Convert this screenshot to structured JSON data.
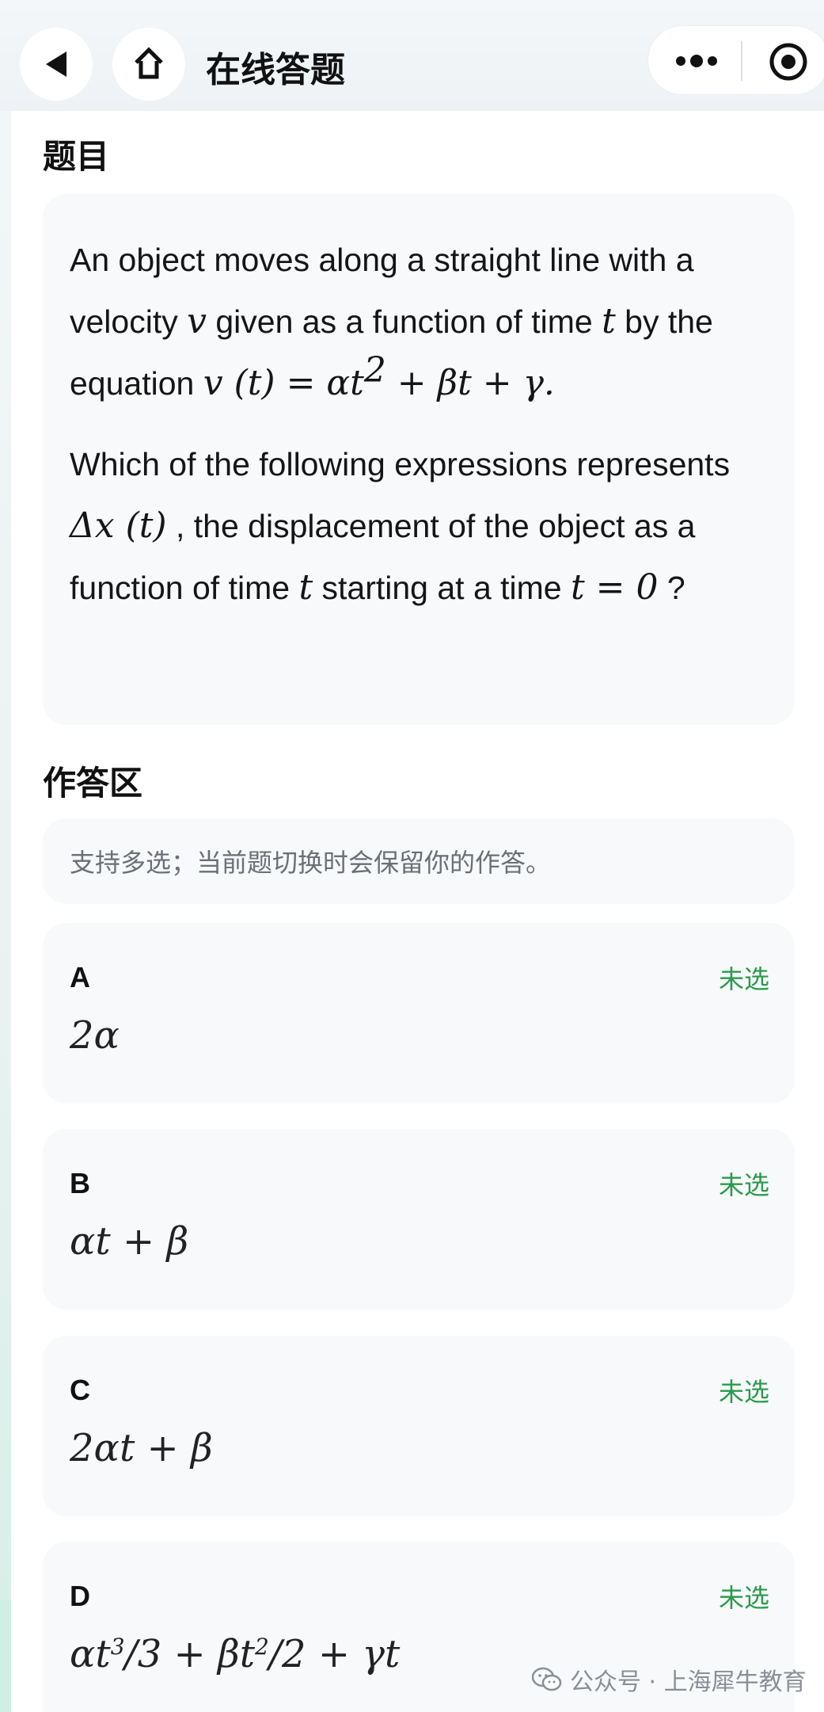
{
  "header": {
    "title": "在线答题"
  },
  "question": {
    "section_title": "题目",
    "p1": {
      "a": "An object moves along a straight line with a velocity ",
      "v": "v",
      "b": " given as a function of time ",
      "t": "t",
      "c": " by the equation ",
      "eq_lhs": "v (t) = αt",
      "eq_exp": "2",
      "eq_rhs": " + βt + γ."
    },
    "p2": {
      "a": "Which of the following expressions represents ",
      "delta": "Δx (t)",
      "b": " , the displacement of the object as a function of time ",
      "t": "t",
      "c": " starting at a time ",
      "t0": "t = 0",
      "d": " ?"
    }
  },
  "answer": {
    "section_title": "作答区",
    "hint": "支持多选；当前题切换时会保留你的作答。",
    "options": [
      {
        "letter": "A",
        "status": "未选",
        "expr": "2α"
      },
      {
        "letter": "B",
        "status": "未选",
        "expr": "αt + β"
      },
      {
        "letter": "C",
        "status": "未选",
        "expr": "2αt + β"
      },
      {
        "letter": "D",
        "status": "未选",
        "expr_a": "αt",
        "exp1": "3",
        "expr_b": "/3 + βt",
        "exp2": "2",
        "expr_c": "/2 + γt"
      }
    ]
  },
  "watermark": {
    "text": "公众号 · 上海犀牛教育",
    "icon": "wechat-icon"
  },
  "colors": {
    "status_green": "#2a9a4a",
    "card_bg": "#f7f9fb",
    "hint_text": "#6b6f76"
  }
}
